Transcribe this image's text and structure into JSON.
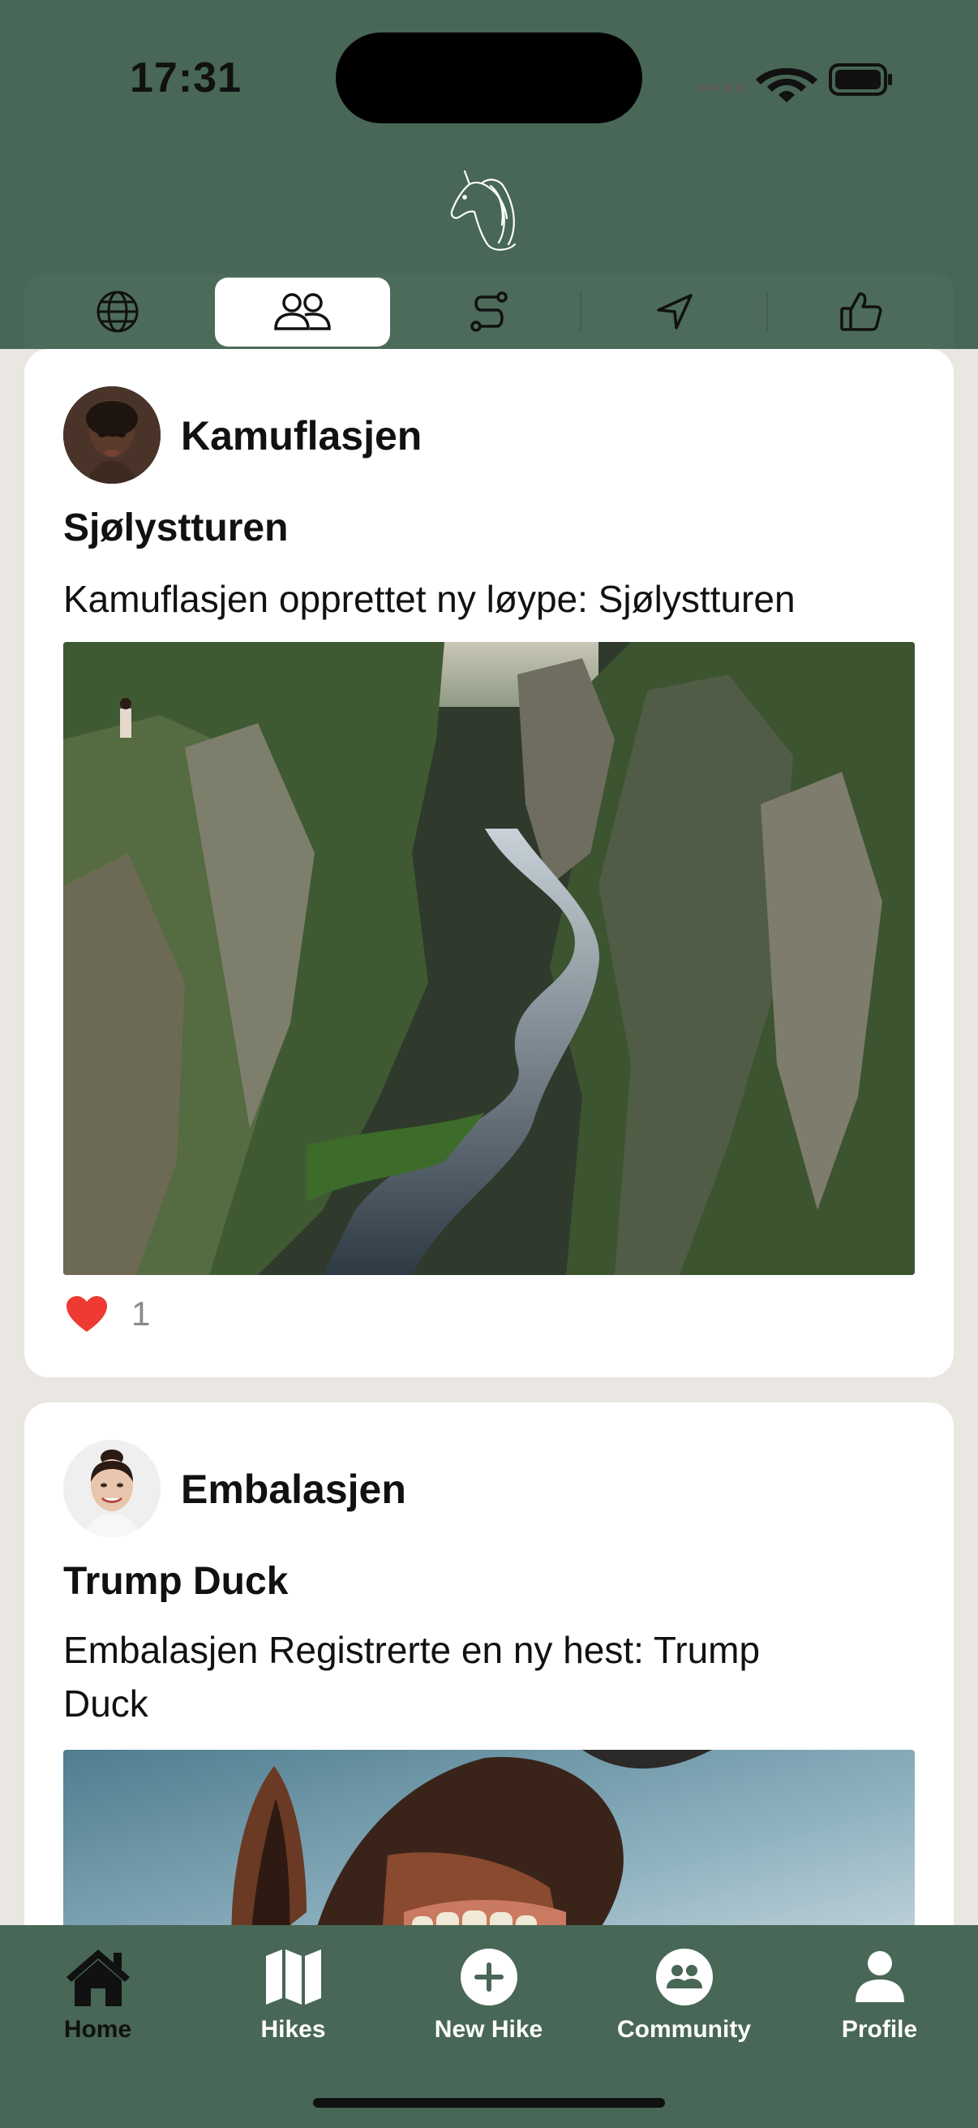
{
  "status_bar": {
    "time": "17:31"
  },
  "segments": [
    {
      "id": "explore",
      "icon": "globe-icon",
      "active": false
    },
    {
      "id": "community",
      "icon": "people-icon",
      "active": true
    },
    {
      "id": "routes",
      "icon": "route-icon",
      "active": false
    },
    {
      "id": "nearby",
      "icon": "location-arrow-icon",
      "active": false
    },
    {
      "id": "liked",
      "icon": "thumbs-up-icon",
      "active": false
    }
  ],
  "feed": [
    {
      "username": "Kamuflasjen",
      "title": "Sjølystturen",
      "text": "Kamuflasjen opprettet ny løype: Sjølystturen",
      "image": "canyon-river-photo",
      "likes": "1"
    },
    {
      "username": "Embalasjen",
      "title": "Trump Duck",
      "text": "Embalasjen Registrerte en ny hest: Trump Duck",
      "image": "horse-teeth-photo"
    }
  ],
  "tabbar": {
    "home": "Home",
    "hikes": "Hikes",
    "new_hike": "New Hike",
    "community": "Community",
    "profile": "Profile"
  },
  "colors": {
    "header": "#486756",
    "background": "#eae7e2",
    "like": "#ee3a33"
  }
}
